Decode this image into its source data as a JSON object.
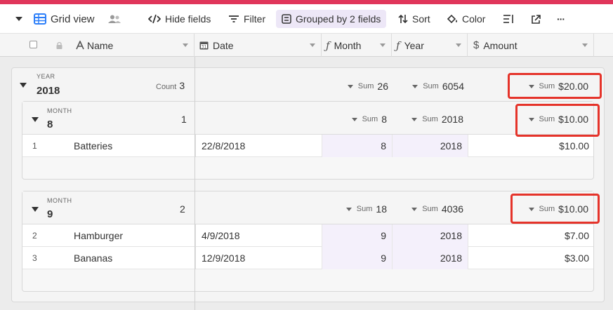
{
  "toolbar": {
    "view_name": "Grid view",
    "hide_fields": "Hide fields",
    "filter": "Filter",
    "grouped": "Grouped by 2 fields",
    "sort": "Sort",
    "color": "Color",
    "more": "···"
  },
  "columns": [
    {
      "label": "Name",
      "icon": "text-icon"
    },
    {
      "label": "Date",
      "icon": "calendar-icon"
    },
    {
      "label": "Month",
      "icon": "formula-icon"
    },
    {
      "label": "Year",
      "icon": "formula-icon"
    },
    {
      "label": "Amount",
      "icon": "currency-icon"
    }
  ],
  "group": {
    "field": "YEAR",
    "value": "2018",
    "count_label": "Count",
    "count": "3",
    "sum_label": "Sum",
    "sum_month": "26",
    "sum_year": "6054",
    "sum_amount": "$20.00",
    "subgroups": [
      {
        "field": "MONTH",
        "value": "8",
        "count": "1",
        "sum_month": "8",
        "sum_year": "2018",
        "sum_amount": "$10.00",
        "rows": [
          {
            "num": "1",
            "name": "Batteries",
            "date": "22/8/2018",
            "month": "8",
            "year": "2018",
            "amount": "$10.00"
          }
        ]
      },
      {
        "field": "MONTH",
        "value": "9",
        "count": "2",
        "sum_month": "18",
        "sum_year": "4036",
        "sum_amount": "$10.00",
        "rows": [
          {
            "num": "2",
            "name": "Hamburger",
            "date": "4/9/2018",
            "month": "9",
            "year": "2018",
            "amount": "$7.00"
          },
          {
            "num": "3",
            "name": "Bananas",
            "date": "12/9/2018",
            "month": "9",
            "year": "2018",
            "amount": "$3.00"
          }
        ]
      }
    ]
  },
  "colors": {
    "accent_bar": "#e0365b",
    "grouped_bg": "#ede7f7",
    "highlight": "#e5332a",
    "formula_cell_bg": "#f4f0fb",
    "grid_icon": "#2d7ff9"
  }
}
